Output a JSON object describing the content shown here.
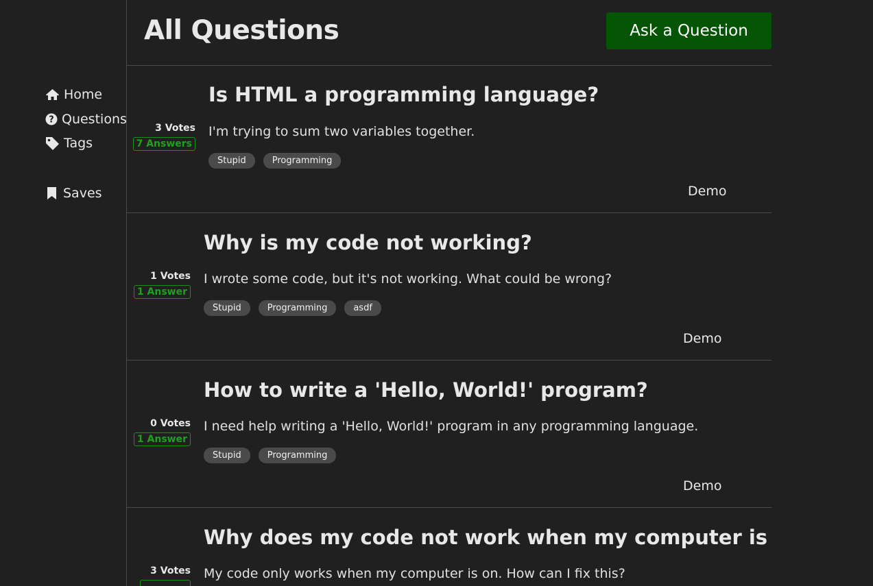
{
  "sidebar": {
    "items": [
      {
        "label": "Home",
        "icon": "home-icon"
      },
      {
        "label": "Questions",
        "icon": "question-circle-icon"
      },
      {
        "label": "Tags",
        "icon": "tag-icon"
      },
      {
        "label": "Saves",
        "icon": "bookmark-icon"
      }
    ]
  },
  "header": {
    "title": "All Questions",
    "ask_label": "Ask a Question"
  },
  "colors": {
    "background": "#202020",
    "accent_button": "#035503",
    "answers_green": "#1fa01f",
    "tag_bg": "#4a4a4a"
  },
  "questions": [
    {
      "votes": "3 Votes",
      "answers": "7 Answers",
      "title": "Is HTML a programming language?",
      "body": "I'm trying to sum two variables together.",
      "tags": [
        "Stupid",
        "Programming"
      ],
      "author": "Demo"
    },
    {
      "votes": "1 Votes",
      "answers": "1 Answer",
      "title": "Why is my code not working?",
      "body": "I wrote some code, but it's not working. What could be wrong?",
      "tags": [
        "Stupid",
        "Programming",
        "asdf"
      ],
      "author": "Demo"
    },
    {
      "votes": "0 Votes",
      "answers": "1 Answer",
      "title": "How to write a 'Hello, World!' program?",
      "body": "I need help writing a 'Hello, World!' program in any programming language.",
      "tags": [
        "Stupid",
        "Programming"
      ],
      "author": "Demo"
    },
    {
      "votes": "3 Votes",
      "answers": "",
      "title": "Why does my code not work when my computer is off?",
      "body": "My code only works when my computer is on. How can I fix this?",
      "tags": [],
      "author": ""
    }
  ]
}
